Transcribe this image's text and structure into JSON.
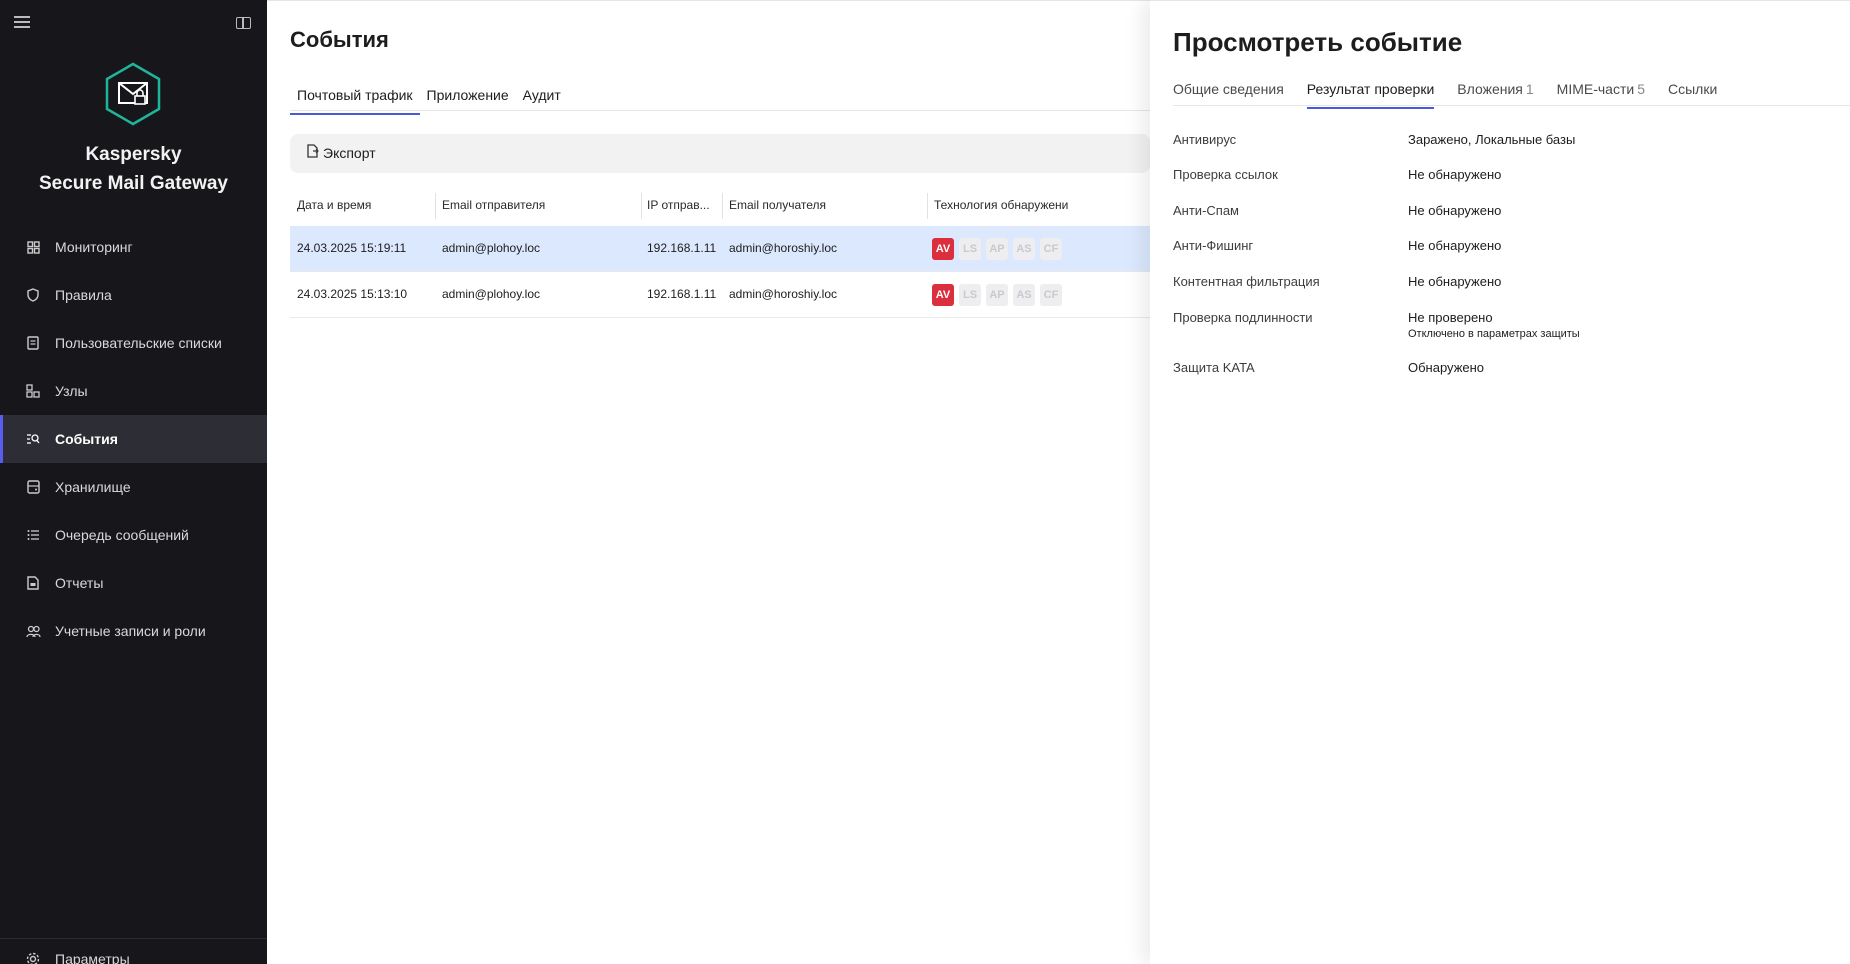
{
  "sidebar": {
    "brand_line1": "Kaspersky",
    "brand_line2": "Secure Mail Gateway",
    "items": [
      {
        "label": "Мониторинг",
        "icon": "dashboard-icon"
      },
      {
        "label": "Правила",
        "icon": "shield-icon"
      },
      {
        "label": "Пользовательские списки",
        "icon": "list-doc-icon"
      },
      {
        "label": "Узлы",
        "icon": "nodes-icon"
      },
      {
        "label": "События",
        "icon": "events-search-icon",
        "active": true
      },
      {
        "label": "Хранилище",
        "icon": "storage-icon"
      },
      {
        "label": "Очередь сообщений",
        "icon": "queue-icon"
      },
      {
        "label": "Отчеты",
        "icon": "report-icon"
      },
      {
        "label": "Учетные записи и роли",
        "icon": "users-icon"
      }
    ],
    "bottom_label": "Параметры"
  },
  "main": {
    "title": "События",
    "tabs": [
      "Почтовый трафик",
      "Приложение",
      "Аудит"
    ],
    "export_label": "Экспорт",
    "columns": [
      "Дата и время",
      "Email отправителя",
      "IP отправ...",
      "Email получателя",
      "Технология обнаружени"
    ],
    "rows": [
      {
        "datetime": "24.03.2025 15:19:11",
        "sender": "admin@plohoy.loc",
        "ip": "192.168.1.11",
        "recipient": "admin@horoshiy.loc",
        "badges": [
          "AV",
          "LS",
          "AP",
          "AS",
          "CF"
        ]
      },
      {
        "datetime": "24.03.2025 15:13:10",
        "sender": "admin@plohoy.loc",
        "ip": "192.168.1.11",
        "recipient": "admin@horoshiy.loc",
        "badges": [
          "AV",
          "LS",
          "AP",
          "AS",
          "CF"
        ]
      }
    ]
  },
  "panel": {
    "title": "Просмотреть событие",
    "tabs": [
      {
        "label": "Общие сведения",
        "count": ""
      },
      {
        "label": "Результат проверки",
        "count": ""
      },
      {
        "label": "Вложения",
        "count": "1"
      },
      {
        "label": "MIME-части",
        "count": "5"
      },
      {
        "label": "Ссылки",
        "count": ""
      }
    ],
    "results": [
      {
        "label": "Антивирус",
        "value": "Заражено, Локальные базы"
      },
      {
        "label": "Проверка ссылок",
        "value": "Не обнаружено"
      },
      {
        "label": "Анти-Спам",
        "value": "Не обнаружено"
      },
      {
        "label": "Анти-Фишинг",
        "value": "Не обнаружено"
      },
      {
        "label": "Контентная фильтрация",
        "value": "Не обнаружено"
      },
      {
        "label": "Проверка подлинности",
        "value": "Не проверено",
        "sub": "Отключено в параметрах защиты"
      },
      {
        "label": "Защита KATA",
        "value": "Обнаружено"
      }
    ]
  },
  "colors": {
    "accent": "#4b5bd8",
    "alert": "#dc2f3d",
    "sidebar_bg": "#17171b",
    "selected_row": "#dbe8fd"
  }
}
